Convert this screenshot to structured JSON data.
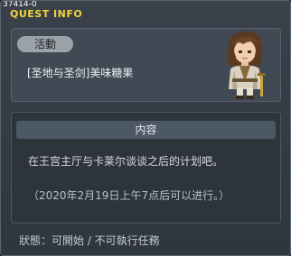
{
  "window": {
    "quest_id": "37414-0",
    "title": "QUEST INFO"
  },
  "quest": {
    "category": "活動",
    "name": "[圣地与圣剑]美味糖果",
    "npc_icon": "npc-portrait-icon"
  },
  "content": {
    "header": "内容",
    "description": "在王宫主厅与卡莱尔谈谈之后的计划吧。",
    "time_note": "（2020年2月19日上午7点后可以进行。）"
  },
  "status": {
    "text": "狀態：可開始 / 不可執行任務"
  },
  "colors": {
    "title": "#f2d23b",
    "badge": "#9ba2aa",
    "header_bar": "#4c5866"
  }
}
